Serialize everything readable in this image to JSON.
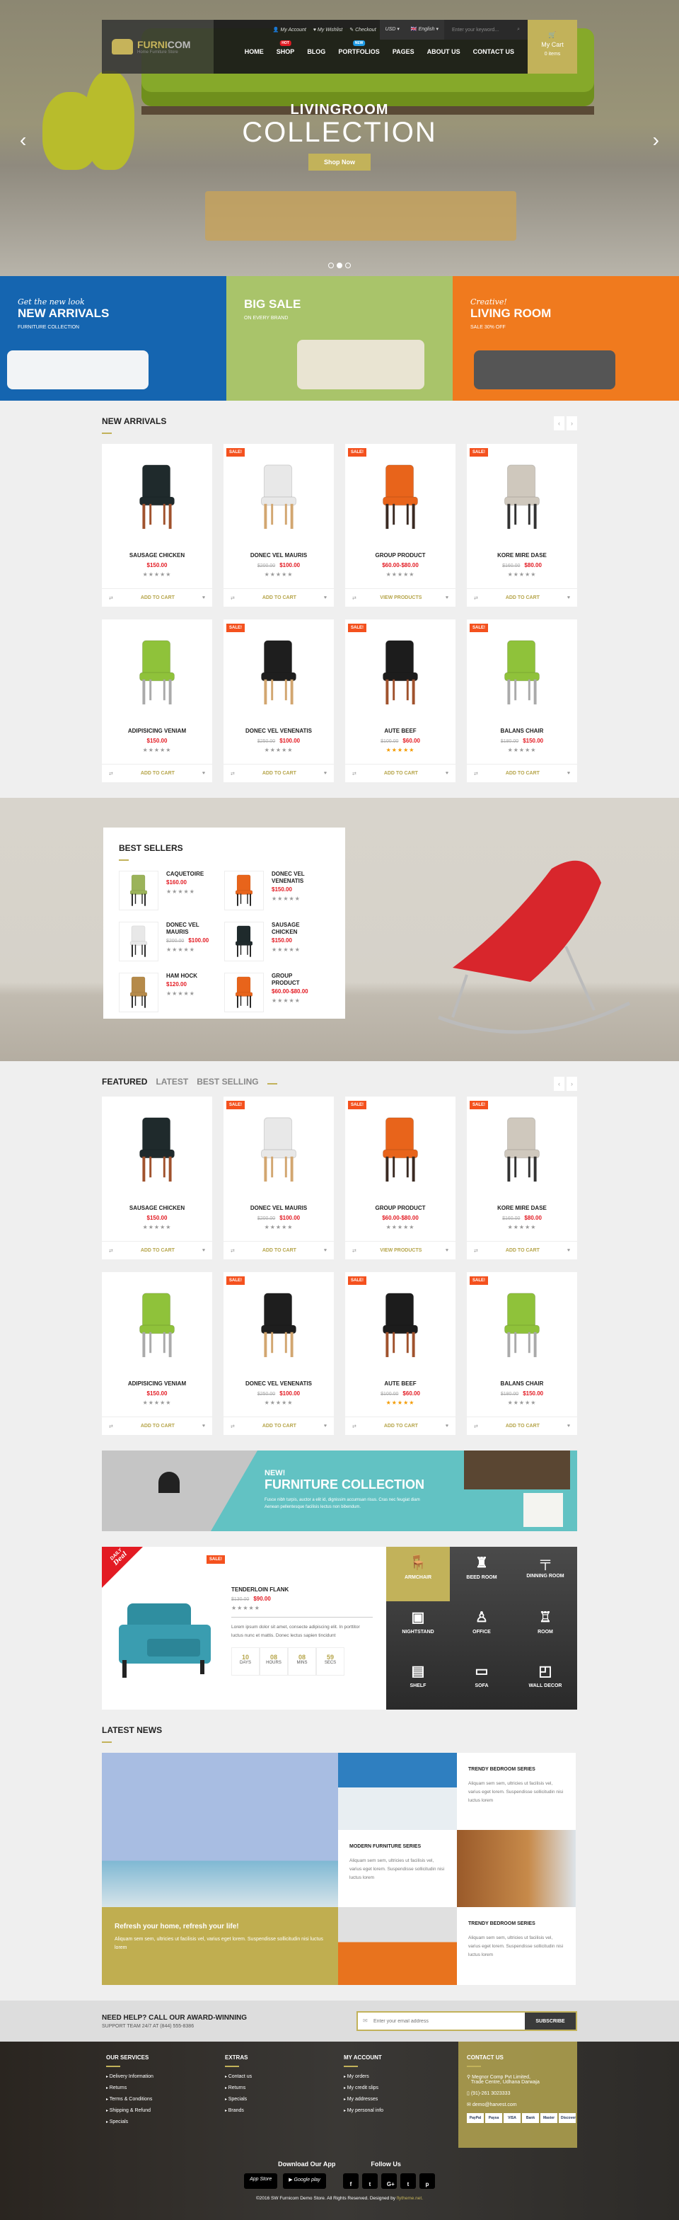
{
  "colors": {
    "accent": "#c2b25a",
    "sale": "#f4511e",
    "price": "#e31b23",
    "dark": "#222222"
  },
  "header": {
    "logo_name_a": "FURNI",
    "logo_name_b": "COM",
    "logo_tagline": "Home Furniture Store",
    "top_links": [
      "My Account",
      "My Wishlist",
      "Checkout"
    ],
    "currency": "USD",
    "language": "English",
    "search_placeholder": "Enter your keyword...",
    "nav": [
      {
        "label": "HOME"
      },
      {
        "label": "SHOP",
        "badge": "HOT",
        "badge_color": "#e31b23"
      },
      {
        "label": "BLOG"
      },
      {
        "label": "PORTFOLIOS",
        "badge": "NEW",
        "badge_color": "#1e9be6"
      },
      {
        "label": "PAGES"
      },
      {
        "label": "ABOUT US"
      },
      {
        "label": "CONTACT US"
      }
    ],
    "cart_label": "My Cart",
    "cart_count": "0 items"
  },
  "hero": {
    "line1": "LIVINGROOM",
    "line2": "COLLECTION",
    "button": "Shop Now",
    "slides": 3,
    "active_slide": 2
  },
  "banners": [
    {
      "script": "Get the new look",
      "title": "NEW ARRIVALS",
      "sub": "FURNITURE COLLECTION",
      "bg": "#1565b0"
    },
    {
      "script": "",
      "title": "BIG SALE",
      "sub": "ON EVERY BRAND",
      "bg": "#a9c46a"
    },
    {
      "script": "Creative!",
      "title": "LIVING ROOM",
      "sub": "SALE 30% OFF",
      "bg": "#f07a1e"
    }
  ],
  "new_arrivals": {
    "title": "NEW ARRIVALS"
  },
  "products": [
    {
      "name": "SAUSAGE CHICKEN",
      "price": "$150.00",
      "old": "",
      "sale": false,
      "rating": 0,
      "cta": "ADD TO CART",
      "seat": "#1f2a2c",
      "leg": "#a0522d"
    },
    {
      "name": "DONEC VEL MAURIS",
      "price": "$100.00",
      "old": "$200.00",
      "sale": true,
      "rating": 0,
      "cta": "ADD TO CART",
      "seat": "#e8e8e8",
      "leg": "#d2a670"
    },
    {
      "name": "GROUP PRODUCT",
      "price": "$60.00-$80.00",
      "old": "",
      "sale": true,
      "rating": 0,
      "cta": "VIEW PRODUCTS",
      "seat": "#e8641b",
      "leg": "#3a2a22"
    },
    {
      "name": "KORE MIRE DASE",
      "price": "$80.00",
      "old": "$160.00",
      "sale": true,
      "rating": 0,
      "cta": "ADD TO CART",
      "seat": "#cfc8bd",
      "leg": "#333333"
    },
    {
      "name": "ADIPISICING VENIAM",
      "price": "$150.00",
      "old": "",
      "sale": false,
      "rating": 0,
      "cta": "ADD TO CART",
      "seat": "#8fc23a",
      "leg": "#aaaaaa"
    },
    {
      "name": "DONEC VEL VENENATIS",
      "price": "$100.00",
      "old": "$250.00",
      "sale": true,
      "rating": 0,
      "cta": "ADD TO CART",
      "seat": "#1e1e1e",
      "leg": "#d2a670"
    },
    {
      "name": "AUTE BEEF",
      "price": "$60.00",
      "old": "$100.00",
      "sale": true,
      "rating": 5,
      "cta": "ADD TO CART",
      "seat": "#1c1c1c",
      "leg": "#a0522d"
    },
    {
      "name": "BALANS CHAIR",
      "price": "$150.00",
      "old": "$180.00",
      "sale": true,
      "rating": 0,
      "cta": "ADD TO CART",
      "seat": "#8fc23a",
      "leg": "#aaaaaa"
    }
  ],
  "sale_label": "SALE!",
  "best_sellers": {
    "title": "BEST SELLERS",
    "items": [
      {
        "name": "CAQUETOIRE",
        "price": "$160.00",
        "old": "",
        "seat": "#9bb35a"
      },
      {
        "name": "DONEC VEL VENENATIS",
        "price": "$150.00",
        "old": "",
        "seat": "#e8641b"
      },
      {
        "name": "DONEC VEL MAURIS",
        "price": "$100.00",
        "old": "$200.00",
        "seat": "#e8e8e8"
      },
      {
        "name": "SAUSAGE CHICKEN",
        "price": "$150.00",
        "old": "",
        "seat": "#1f2a2c"
      },
      {
        "name": "HAM HOCK",
        "price": "$120.00",
        "old": "",
        "seat": "#b58a4a"
      },
      {
        "name": "GROUP PRODUCT",
        "price": "$60.00-$80.00",
        "old": "",
        "seat": "#e8641b"
      }
    ]
  },
  "featured": {
    "tabs": [
      "FEATURED",
      "LATEST",
      "BEST SELLING"
    ],
    "active_tab": 0
  },
  "promo": {
    "kicker": "NEW!",
    "title": "FURNITURE COLLECTION",
    "text": "Fusce nibh turpis, auctor a elit id, dignissim accumsan risus. Cras nec feugiat diam Aenean pellentesque facilisis lectus non bibendum."
  },
  "deal": {
    "ribbon_small": "DAILY",
    "ribbon_big": "Deal",
    "sale": "SALE!",
    "name": "TENDERLOIN FLANK",
    "old": "$130.00",
    "price": "$90.00",
    "rating": 0,
    "desc": "Lorem ipsum dolor sit amet, consecte adipiscing elit. In porttitor luctus nunc et mattis. Donec lectus sapien tincidunt",
    "countdown": [
      {
        "v": "10",
        "l": "DAYS"
      },
      {
        "v": "08",
        "l": "HOURS"
      },
      {
        "v": "08",
        "l": "MINS"
      },
      {
        "v": "59",
        "l": "SECS"
      }
    ],
    "categories": [
      {
        "label": "ARMCHAIR",
        "icon": "armchair-icon",
        "glyph": "🪑",
        "active": true
      },
      {
        "label": "BEED ROOM",
        "icon": "lamp-icon",
        "glyph": "♜"
      },
      {
        "label": "DINNING ROOM",
        "icon": "table-icon",
        "glyph": "╤"
      },
      {
        "label": "NIGHTSTAND",
        "icon": "nightstand-icon",
        "glyph": "▣"
      },
      {
        "label": "OFFICE",
        "icon": "office-chair-icon",
        "glyph": "♙"
      },
      {
        "label": "ROOM",
        "icon": "floor-lamp-icon",
        "glyph": "♖"
      },
      {
        "label": "SHELF",
        "icon": "shelf-icon",
        "glyph": "▤"
      },
      {
        "label": "SOFA",
        "icon": "sofa-icon",
        "glyph": "▭"
      },
      {
        "label": "WALL DECOR",
        "icon": "frame-icon",
        "glyph": "◰"
      }
    ]
  },
  "news": {
    "title": "LATEST NEWS",
    "feature_title": "Refresh your home, refresh your life!",
    "feature_text": "Aliquam sem sem, ultricies ut facilisis vel, varius eget lorem. Suspendisse sollicitudin nisi luctus lorem",
    "posts": [
      {
        "title": "TRENDY BEDROOM SERIES",
        "text": "Aliquam sem sem, ultricies ut facilisis vel, varius eget lorem. Suspendisse sollicitudin nisi luctus lorem"
      },
      {
        "title": "MODERN FURNITURE SERIES",
        "text": "Aliquam sem sem, ultricies ut facilisis vel, varius eget lorem. Suspendisse sollicitudin nisi luctus lorem"
      },
      {
        "title": "TRENDY BEDROOM SERIES",
        "text": "Aliquam sem sem, ultricies ut facilisis vel, varius eget lorem. Suspendisse sollicitudin nisi luctus lorem"
      }
    ]
  },
  "newsletter": {
    "title": "NEED HELP? CALL OUR AWARD-WINNING",
    "sub": "SUPPORT TEAM 24/7 AT (844) 555-8386",
    "placeholder": "Enter your email address",
    "button": "SUBSCRIBE"
  },
  "footer": {
    "cols": [
      {
        "title": "OUR SERVICES",
        "links": [
          "Delivery Information",
          "Returns",
          "Terms & Conditions",
          "Shipping & Refund",
          "Specials"
        ]
      },
      {
        "title": "EXTRAS",
        "links": [
          "Contact us",
          "Returns",
          "Specials",
          "Brands"
        ]
      },
      {
        "title": "MY ACCOUNT",
        "links": [
          "My orders",
          "My credit slips",
          "My addresses",
          "My personal info"
        ]
      }
    ],
    "contact": {
      "title": "CONTACT US",
      "address1": "Megnor Comp Pvt Limited,",
      "address2": "Trade Centre, Udhana Darwaja",
      "phone": "(91)-261 3023333",
      "email": "demo@harvest.com",
      "payments": [
        "PayPal",
        "Paysa",
        "VISA",
        "Bank",
        "Master",
        "Discover"
      ]
    },
    "app_title": "Download Our App",
    "follow_title": "Follow Us",
    "apps": [
      "App Store",
      "Google play"
    ],
    "social": [
      "f",
      "t",
      "G+",
      "t",
      "p"
    ],
    "copyright": "©2016 SW Furnicom Demo Store. All Rights Reserved. Designed by ",
    "designer": "flytheme.net."
  }
}
